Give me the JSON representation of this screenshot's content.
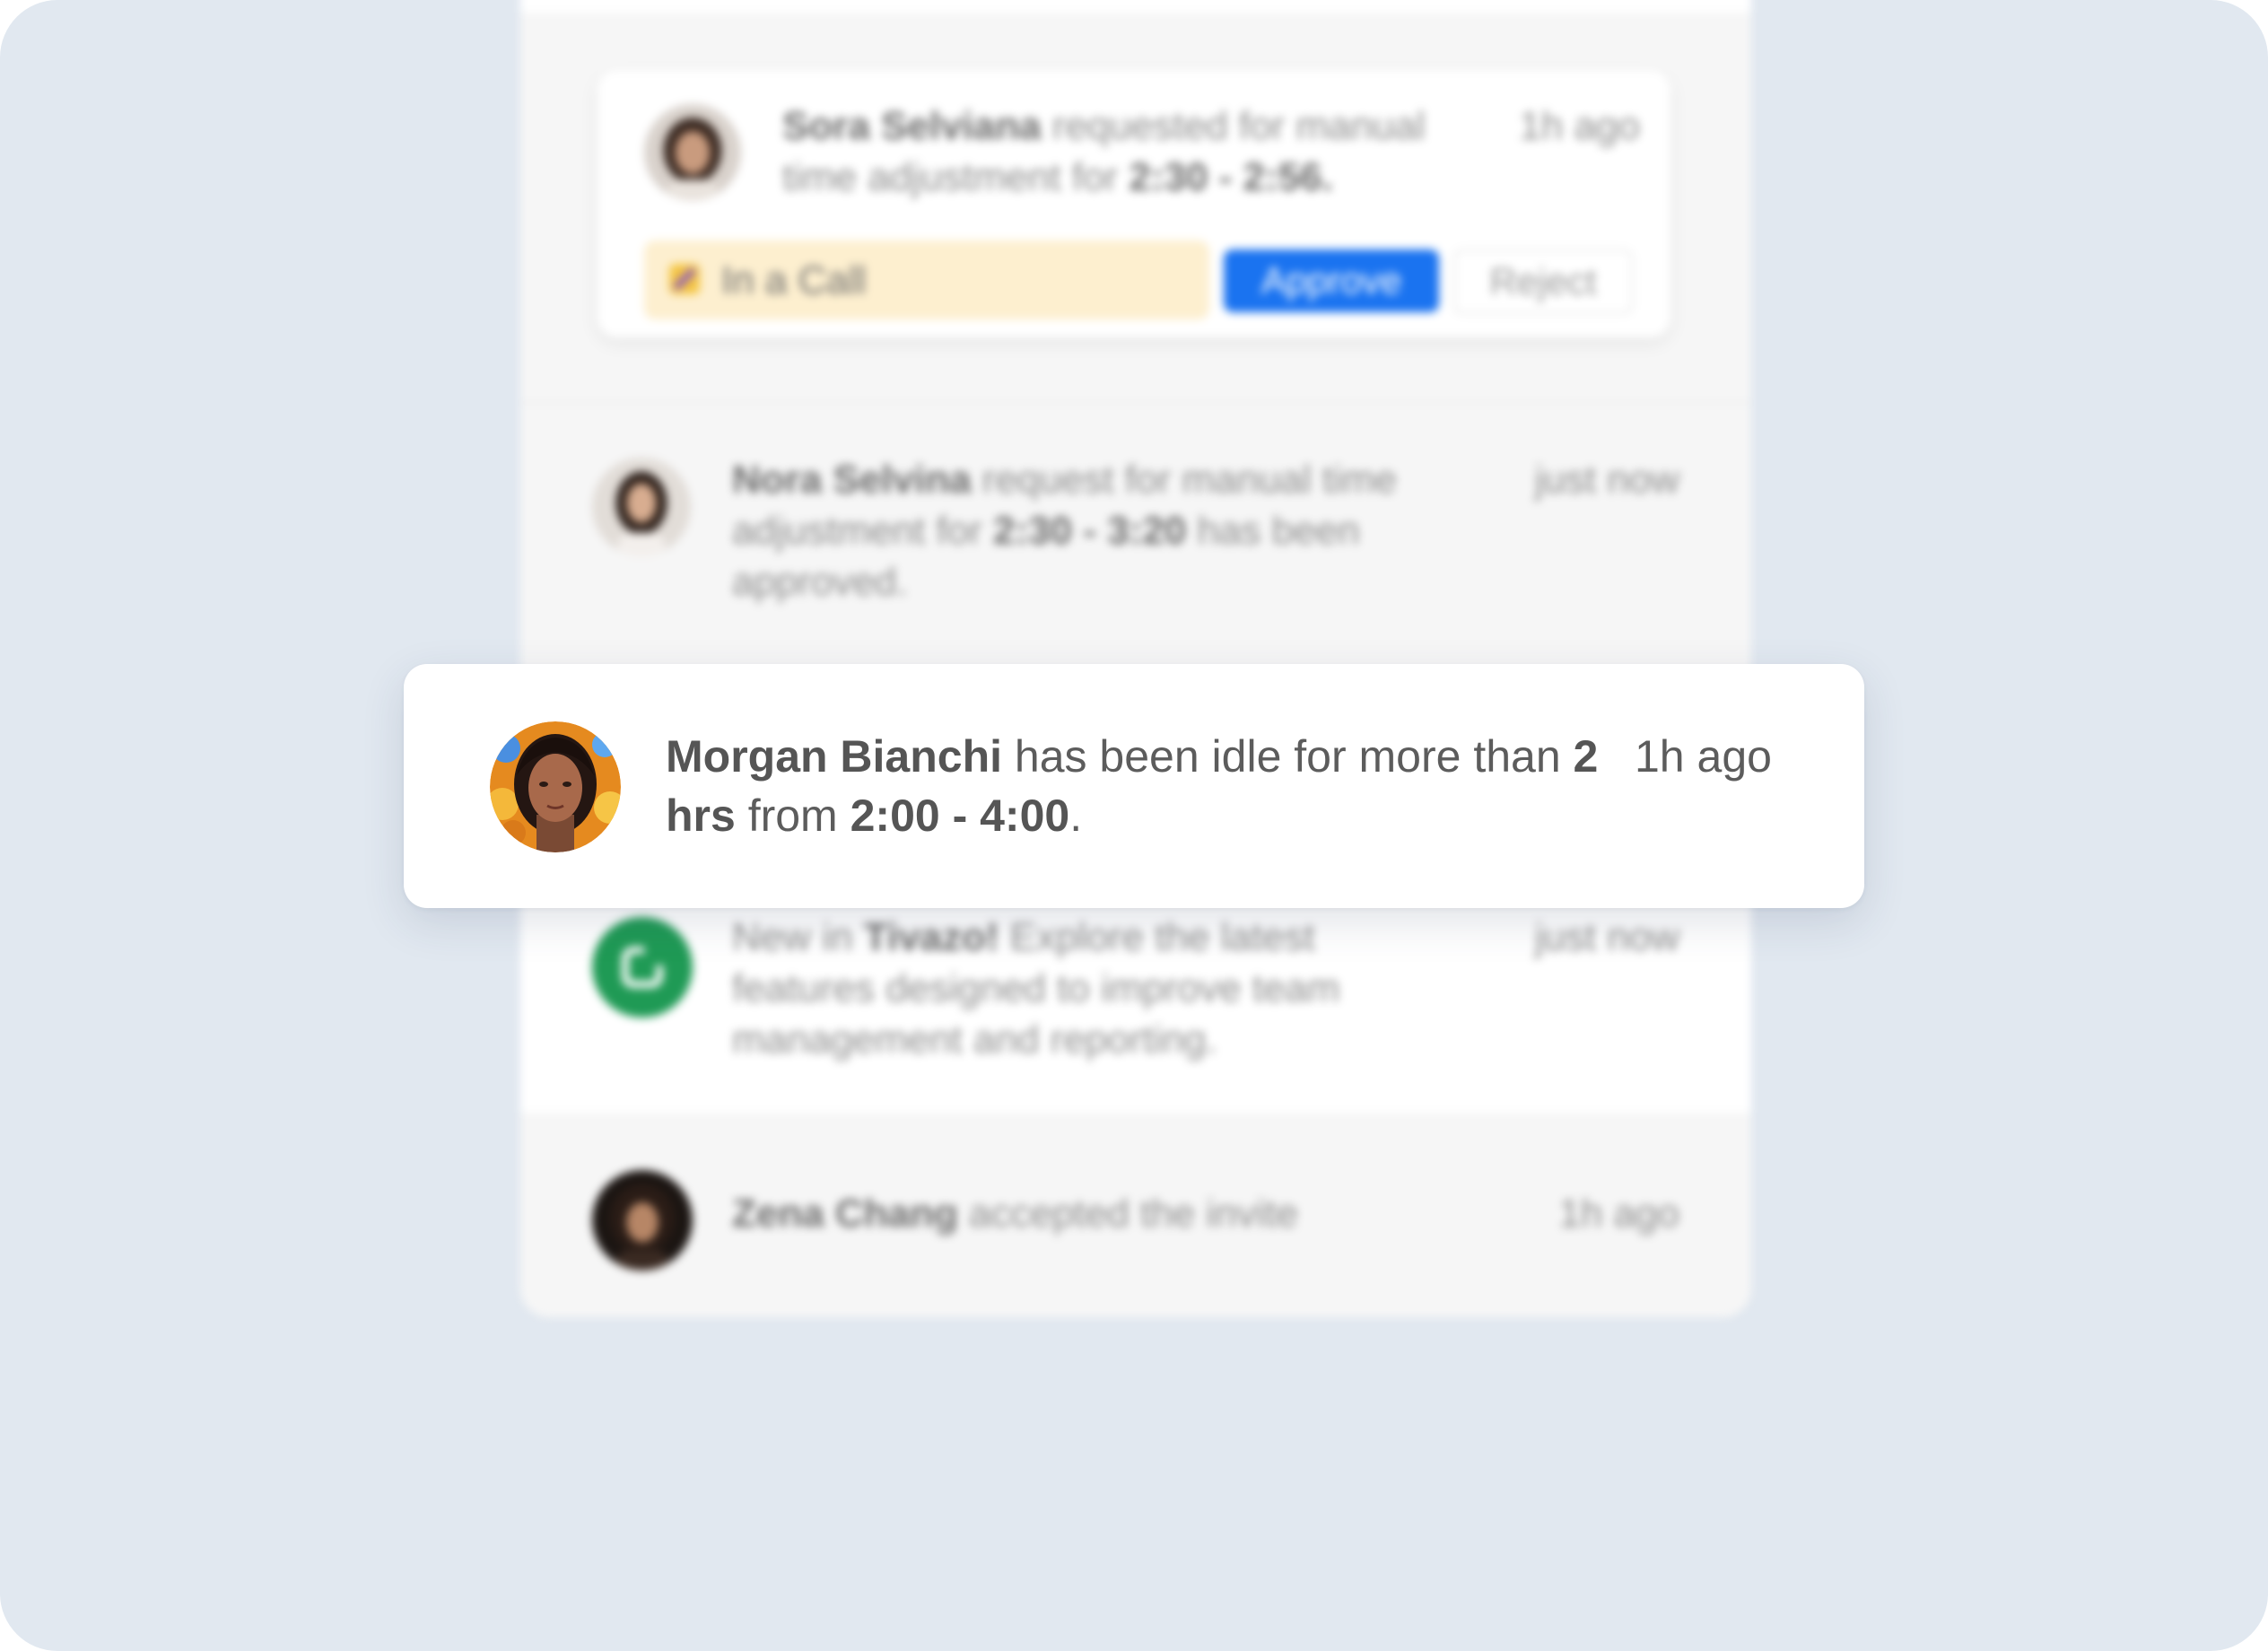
{
  "request_card": {
    "name": "Sora Selviana",
    "message_pre": " requested for manual time adjustment for ",
    "time_range": "2:30 - 2:56.",
    "time_ago": "1h ago",
    "status_label": "In a Call",
    "approve_label": "Approve",
    "reject_label": "Reject"
  },
  "notifications": [
    {
      "name": "Nora Selvina",
      "message_pre": " request for manual time adjustment for ",
      "time_range": "2:30 - 3:20",
      "message_post": " has been approved.",
      "time_ago": "just now"
    },
    {
      "prefix": "New in ",
      "name": "Tivazo!",
      "message_post": " Explore the latest features designed to improve team management and reporting.",
      "time_ago": "just now"
    },
    {
      "name": "Zena Chang",
      "message_post": " accepted the invite",
      "time_ago": "1h ago"
    }
  ],
  "focused_notification": {
    "name": "Morgan Bianchi",
    "message_pre": " has been idle for more than ",
    "duration": "2 hrs",
    "message_mid": " from ",
    "time_range": "2:00 - 4:00",
    "message_post": ".",
    "time_ago": "1h ago"
  },
  "colors": {
    "page_background": "#e1e8f0",
    "approve_button": "#1a73f0",
    "status_pill": "#fdefcf",
    "brand_icon": "#1f9a55"
  }
}
